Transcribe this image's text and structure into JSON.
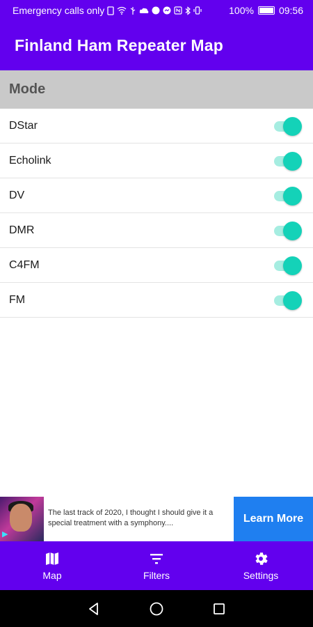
{
  "status_bar": {
    "left_text": "Emergency calls only",
    "battery": "100%",
    "time": "09:56"
  },
  "app_bar": {
    "title": "Finland Ham Repeater Map"
  },
  "settings": {
    "section_title": "Mode",
    "modes": [
      {
        "label": "DStar",
        "enabled": true
      },
      {
        "label": "Echolink",
        "enabled": true
      },
      {
        "label": "DV",
        "enabled": true
      },
      {
        "label": "DMR",
        "enabled": true
      },
      {
        "label": "C4FM",
        "enabled": true
      },
      {
        "label": "FM",
        "enabled": true
      }
    ],
    "switch_color": "#14d2b8"
  },
  "ad": {
    "text": "The last track of 2020, I thought I should give it a special treatment with a symphony....",
    "cta": "Learn More"
  },
  "bottom_nav": {
    "items": [
      {
        "label": "Map",
        "icon": "map-icon"
      },
      {
        "label": "Filters",
        "icon": "filter-icon"
      },
      {
        "label": "Settings",
        "icon": "gear-icon"
      }
    ]
  },
  "colors": {
    "primary": "#6200ee",
    "section_header_bg": "#c9c9c9",
    "cta": "#1f7ff0"
  }
}
